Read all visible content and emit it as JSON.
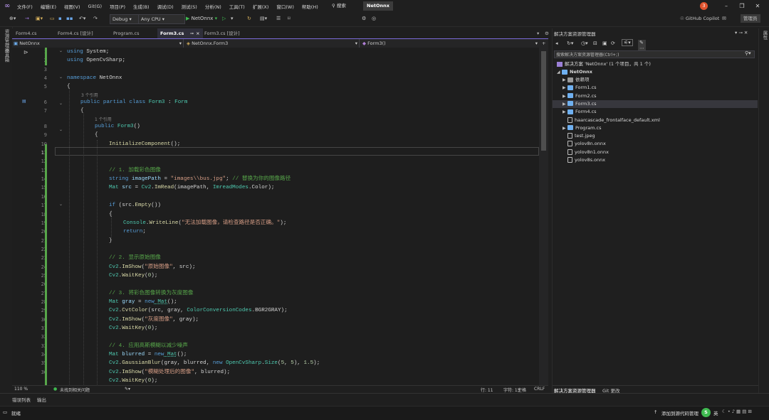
{
  "menu": {
    "items": [
      "文件(F)",
      "编辑(E)",
      "视图(V)",
      "Git(G)",
      "项目(P)",
      "生成(B)",
      "调试(D)",
      "测试(S)",
      "分析(N)",
      "工具(T)",
      "扩展(X)",
      "窗口(W)",
      "帮助(H)"
    ],
    "search_label": "搜索",
    "solution_name": "NetOnnx",
    "notification_count": "3"
  },
  "toolbar": {
    "config": "Debug",
    "platform": "Any CPU",
    "run_target": "NetOnnx",
    "copilot": "GitHub Copilot",
    "admin": "管理员"
  },
  "leftstrip": {
    "items": [
      "资源管理器",
      "工具箱"
    ]
  },
  "rightstrip": {
    "items": [
      "属性"
    ]
  },
  "tabs": [
    {
      "label": "Form4.cs"
    },
    {
      "label": "Form4.cs [设计]"
    },
    {
      "label": "Program.cs"
    },
    {
      "label": "Form3.cs",
      "close": "×"
    },
    {
      "label": "Form3.cs [设计]"
    }
  ],
  "navbar": {
    "project": "NetOnnx",
    "class": "NetOnnx.Form3",
    "member": "Form3()"
  },
  "editor": {
    "line_numbers": [
      1,
      2,
      3,
      4,
      5,
      6,
      7,
      8,
      9,
      10,
      11,
      12,
      13,
      14,
      15,
      16,
      17,
      18,
      19,
      20,
      21,
      22,
      23,
      24,
      25,
      26,
      27,
      28,
      29,
      30,
      31,
      32,
      33,
      34,
      35,
      36
    ],
    "hints": [
      "3 个引用",
      "1 个引用"
    ],
    "lines": {
      "l1_kw": "using",
      "l1_rest": " System;",
      "l2_kw": "using",
      "l2_rest": " OpenCvSharp;",
      "l4_kw": "namespace",
      "l4_rest": " NetOnnx",
      "l5": "{",
      "l6_kw": "public partial class",
      "l6_cls": " Form3",
      "l6_sep": " : ",
      "l6_base": "Form",
      "l7": "{",
      "l8_kw": "public",
      "l8_cls": " Form3",
      "l8_rest": "()",
      "l9": "{",
      "l10_m": "InitializeComponent",
      "l10_rest": "();",
      "l13_cm": "// 1. 加载彩色图像",
      "l14_kw": "string",
      "l14_var": " imagePath",
      "l14_eq": " = ",
      "l14_str": "\"images\\\\bus.jpg\"",
      "l14_semi": "; ",
      "l14_cm": "// 替换为你的图像路径",
      "l15_cls": "Mat",
      "l15_var": " src",
      "l15_eq": " = ",
      "l15_cls2": "Cv2",
      "l15_dot": ".",
      "l15_m": "ImRead",
      "l15_a": "(imagePath, ",
      "l15_cls3": "ImreadModes",
      "l15_b": ".Color);",
      "l17_kw": "if",
      "l17_rest": " (src.",
      "l17_m": "Empty",
      "l17_end": "())",
      "l18": "{",
      "l19_cls": "Console",
      "l19_dot": ".",
      "l19_m": "WriteLine",
      "l19_a": "(",
      "l19_str": "\"无法加载图像，请检查路径是否正确。\"",
      "l19_b": ");",
      "l20_kw": "return",
      "l20_rest": ";",
      "l21": "}",
      "l23_cm": "// 2. 显示原始图像",
      "l24_cls": "Cv2",
      "l24_dot": ".",
      "l24_m": "ImShow",
      "l24_a": "(",
      "l24_str": "\"原始图像\"",
      "l24_b": ", src);",
      "l25_cls": "Cv2",
      "l25_dot": ".",
      "l25_m": "WaitKey",
      "l25_a": "(",
      "l25_num": "0",
      "l25_b": ");",
      "l27_cm": "// 3. 将彩色图像转换为灰度图像",
      "l28_cls": "Mat",
      "l28_var": " gray",
      "l28_eq": " = ",
      "l28_kw": "new",
      "l28_cls2": " Mat",
      "l28_rest": "();",
      "l29_cls": "Cv2",
      "l29_dot": ".",
      "l29_m": "CvtColor",
      "l29_a": "(src, gray, ",
      "l29_cls2": "ColorConversionCodes",
      "l29_b": ".BGR2GRAY);",
      "l30_cls": "Cv2",
      "l30_dot": ".",
      "l30_m": "ImShow",
      "l30_a": "(",
      "l30_str": "\"灰度图像\"",
      "l30_b": ", gray);",
      "l31_cls": "Cv2",
      "l31_dot": ".",
      "l31_m": "WaitKey",
      "l31_a": "(",
      "l31_num": "0",
      "l31_b": ");",
      "l33_cm": "// 4. 应用高斯模糊以减少噪声",
      "l34_cls": "Mat",
      "l34_var": " blurred",
      "l34_eq": " = ",
      "l34_kw": "new",
      "l34_cls2": " Mat",
      "l34_rest": "();",
      "l35_cls": "Cv2",
      "l35_dot": ".",
      "l35_m": "GaussianBlur",
      "l35_a": "(gray, blurred, ",
      "l35_kw": "new",
      "l35_cls2": " OpenCvSharp",
      "l35_dot2": ".",
      "l35_m2": "Size",
      "l35_b": "(",
      "l35_n1": "5",
      "l35_c": ", ",
      "l35_n2": "5",
      "l35_d": "), ",
      "l35_n3": "1.5",
      "l35_e": ");",
      "l36_cls": "Cv2",
      "l36_dot": ".",
      "l36_m": "ImShow",
      "l36_a": "(",
      "l36_str": "\"模糊处理后的图像\"",
      "l36_b": ", blurred);",
      "l37_cls": "Cv2",
      "l37_dot": ".",
      "l37_m": "WaitKey",
      "l37_a": "(",
      "l37_num": "0",
      "l37_b": ");"
    }
  },
  "editor_status": {
    "zoom": "110 %",
    "issues": "未找到相关问题",
    "line": "行: 11",
    "col": "字符: 13",
    "spaces": "空格",
    "eol": "CRLF"
  },
  "solution_explorer": {
    "title": "解决方案资源管理器",
    "search_placeholder": "搜索解决方案资源管理器(Ctrl+;)",
    "solution": "解决方案 'NetOnnx' (1 个项目，共 1 个)",
    "project": "NetOnnx",
    "items": [
      {
        "label": "依赖项",
        "arrow": "▶"
      },
      {
        "label": "Form1.cs",
        "arrow": "▶"
      },
      {
        "label": "Form2.cs",
        "arrow": "▶"
      },
      {
        "label": "Form3.cs",
        "arrow": "▶"
      },
      {
        "label": "Form4.cs",
        "arrow": "▶"
      },
      {
        "label": "haarcascade_frontalface_default.xml",
        "arrow": ""
      },
      {
        "label": "Program.cs",
        "arrow": "▶"
      },
      {
        "label": "test.jpeg",
        "arrow": ""
      },
      {
        "label": "yolov8n.onnx",
        "arrow": ""
      },
      {
        "label": "yolov8n1.onnx",
        "arrow": ""
      },
      {
        "label": "yolov8s.onnx",
        "arrow": ""
      }
    ],
    "bottom_tabs": [
      "解决方案资源管理器",
      "Git 更改"
    ]
  },
  "bottom_panel": {
    "tabs": [
      "错误列表",
      "输出"
    ]
  },
  "statusbar": {
    "ready": "就绪",
    "source_control": "添加到源代码管理",
    "ime": "英"
  },
  "colors": {
    "accent": "#7b6cd9",
    "keyword": "#569cd6",
    "type": "#4ec9b0",
    "string": "#d69d85",
    "comment": "#57a64a",
    "method": "#dcdcaa"
  }
}
